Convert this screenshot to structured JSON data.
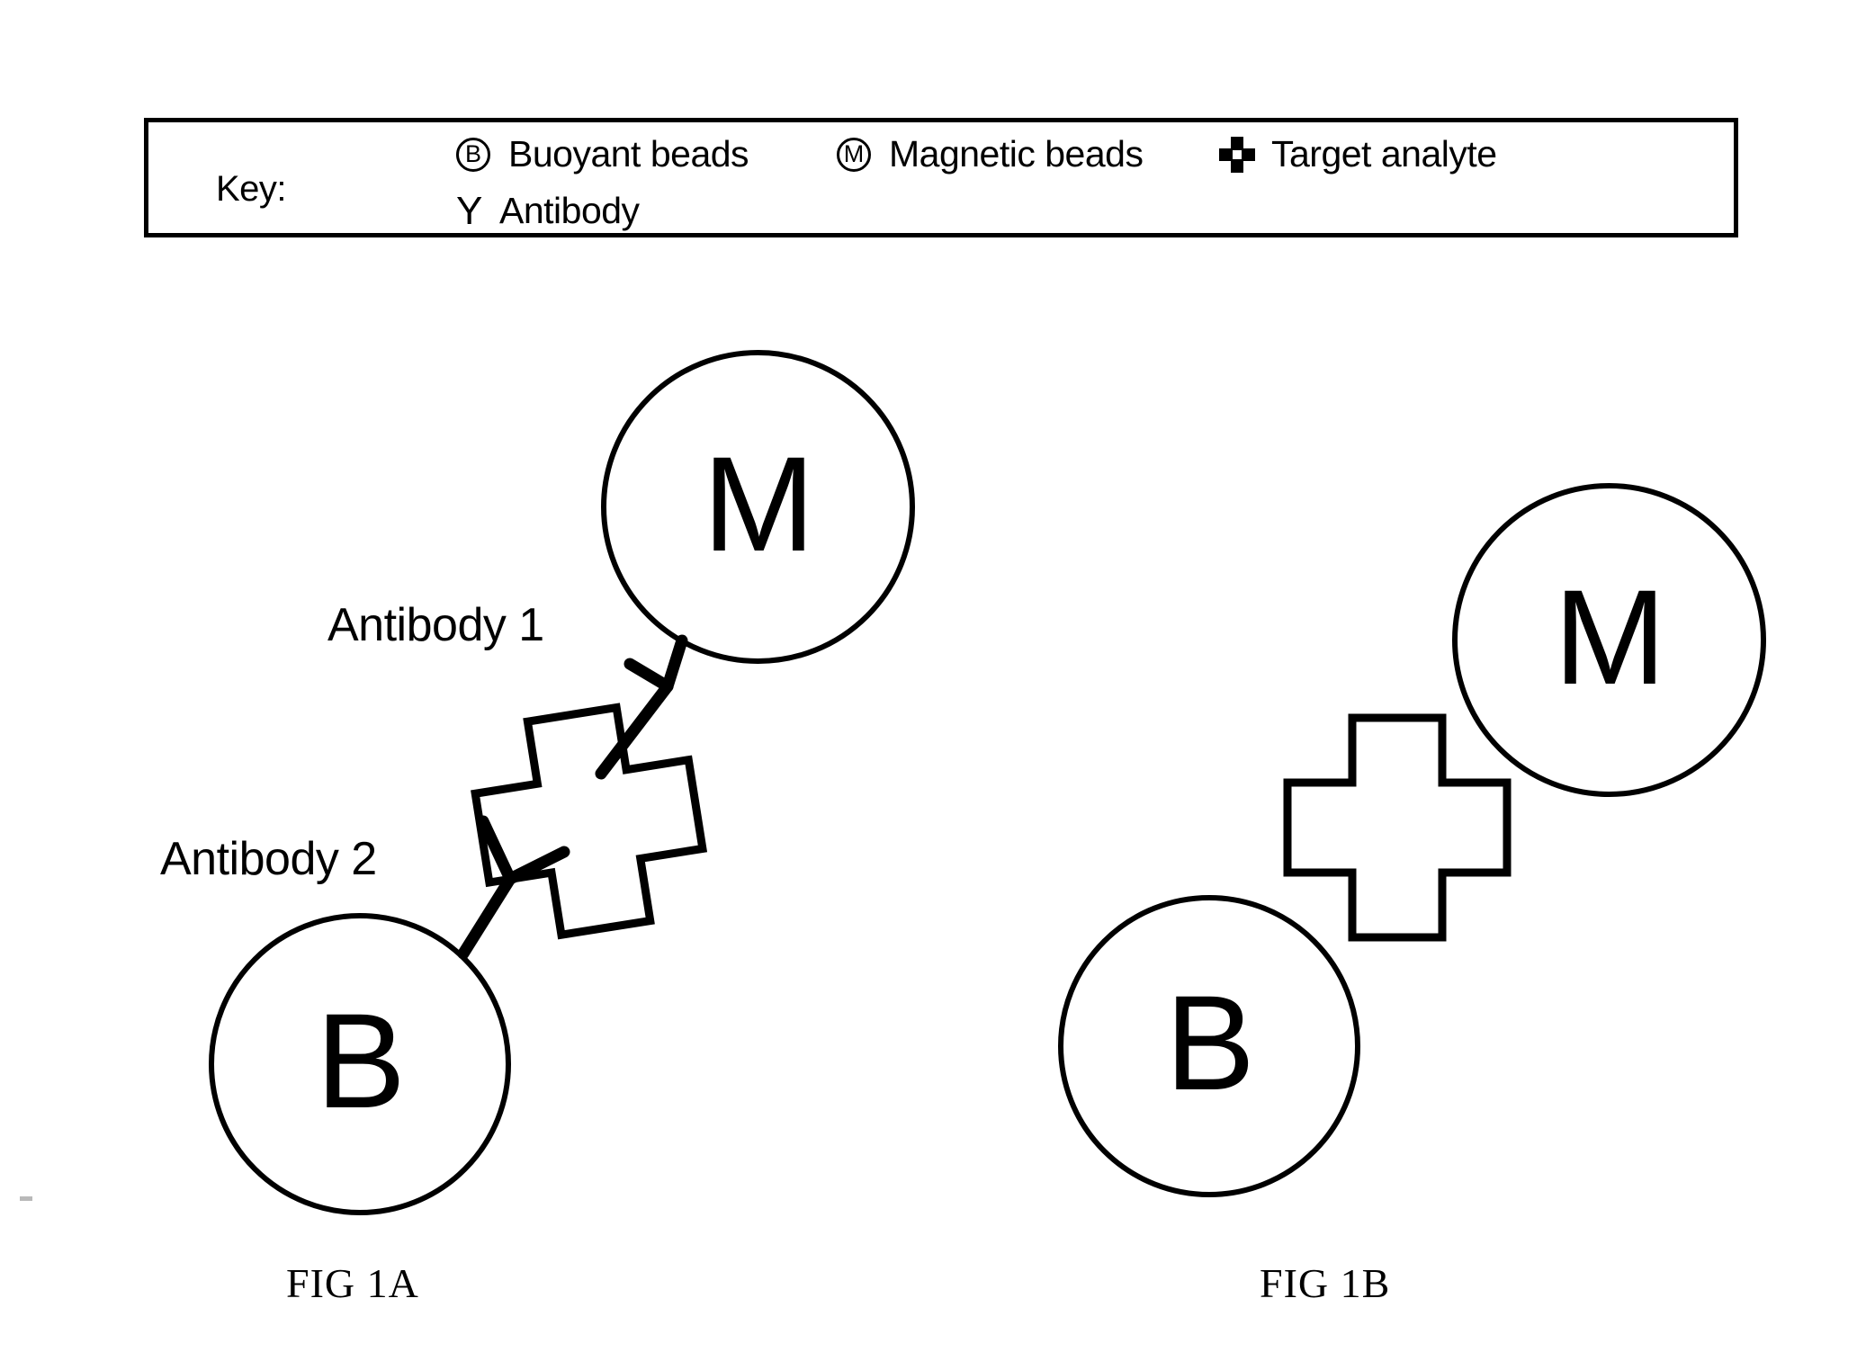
{
  "key": {
    "label": "Key:",
    "entries": [
      {
        "icon": "circled-b-icon",
        "glyph": "B",
        "text": "Buoyant beads"
      },
      {
        "icon": "circled-m-icon",
        "glyph": "M",
        "text": "Magnetic beads"
      },
      {
        "icon": "cross-icon",
        "glyph": "",
        "text": "Target analyte"
      },
      {
        "icon": "antibody-y-icon",
        "glyph": "Y",
        "text": "Antibody"
      }
    ]
  },
  "figures": [
    {
      "caption": "FIG 1A",
      "beads": [
        {
          "name": "magnetic-bead",
          "glyph": "M"
        },
        {
          "name": "buoyant-bead",
          "glyph": "B"
        }
      ],
      "analyte": "target-analyte-cross",
      "annotations": [
        {
          "name": "antibody-1-label",
          "text": "Antibody 1"
        },
        {
          "name": "antibody-2-label",
          "text": "Antibody 2"
        }
      ]
    },
    {
      "caption": "FIG 1B",
      "beads": [
        {
          "name": "magnetic-bead",
          "glyph": "M"
        },
        {
          "name": "buoyant-bead",
          "glyph": "B"
        }
      ],
      "analyte": "target-analyte-cross",
      "annotations": []
    }
  ],
  "colors": {
    "ink": "#000000",
    "background": "#ffffff"
  }
}
